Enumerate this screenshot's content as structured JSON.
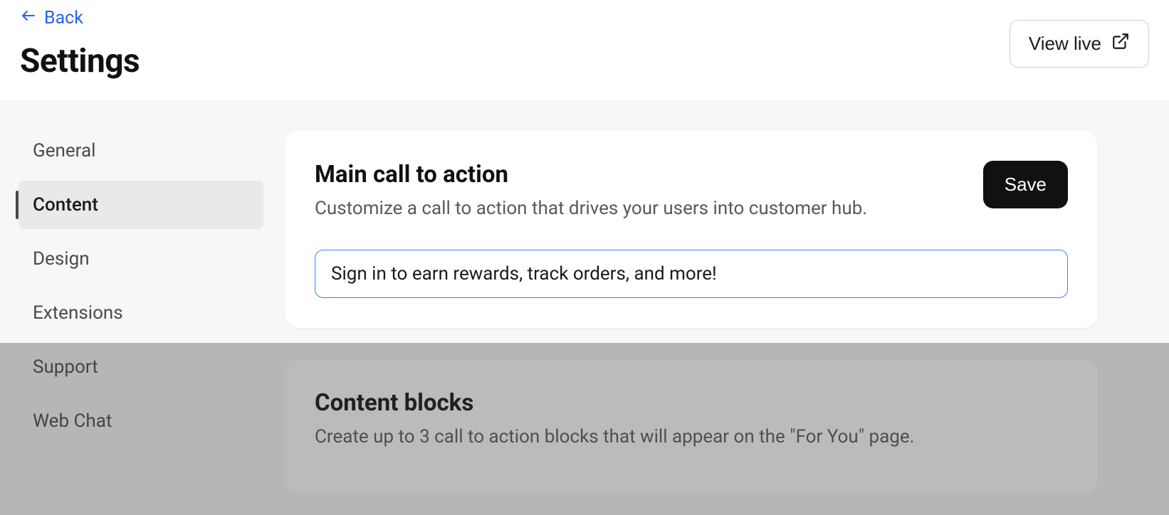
{
  "header": {
    "back_label": "Back",
    "title": "Settings",
    "view_live_label": "View live"
  },
  "sidebar": {
    "items": [
      {
        "label": "General",
        "active": false
      },
      {
        "label": "Content",
        "active": true
      },
      {
        "label": "Design",
        "active": false
      },
      {
        "label": "Extensions",
        "active": false
      },
      {
        "label": "Support",
        "active": false
      },
      {
        "label": "Web Chat",
        "active": false
      }
    ]
  },
  "main": {
    "cta_card": {
      "title": "Main call to action",
      "description": "Customize a call to action that drives your users into customer hub.",
      "save_label": "Save",
      "input_value": "Sign in to earn rewards, track orders, and more!"
    },
    "blocks_card": {
      "title": "Content blocks",
      "description": "Create up to 3 call to action blocks that will appear on the \"For You\" page."
    }
  }
}
